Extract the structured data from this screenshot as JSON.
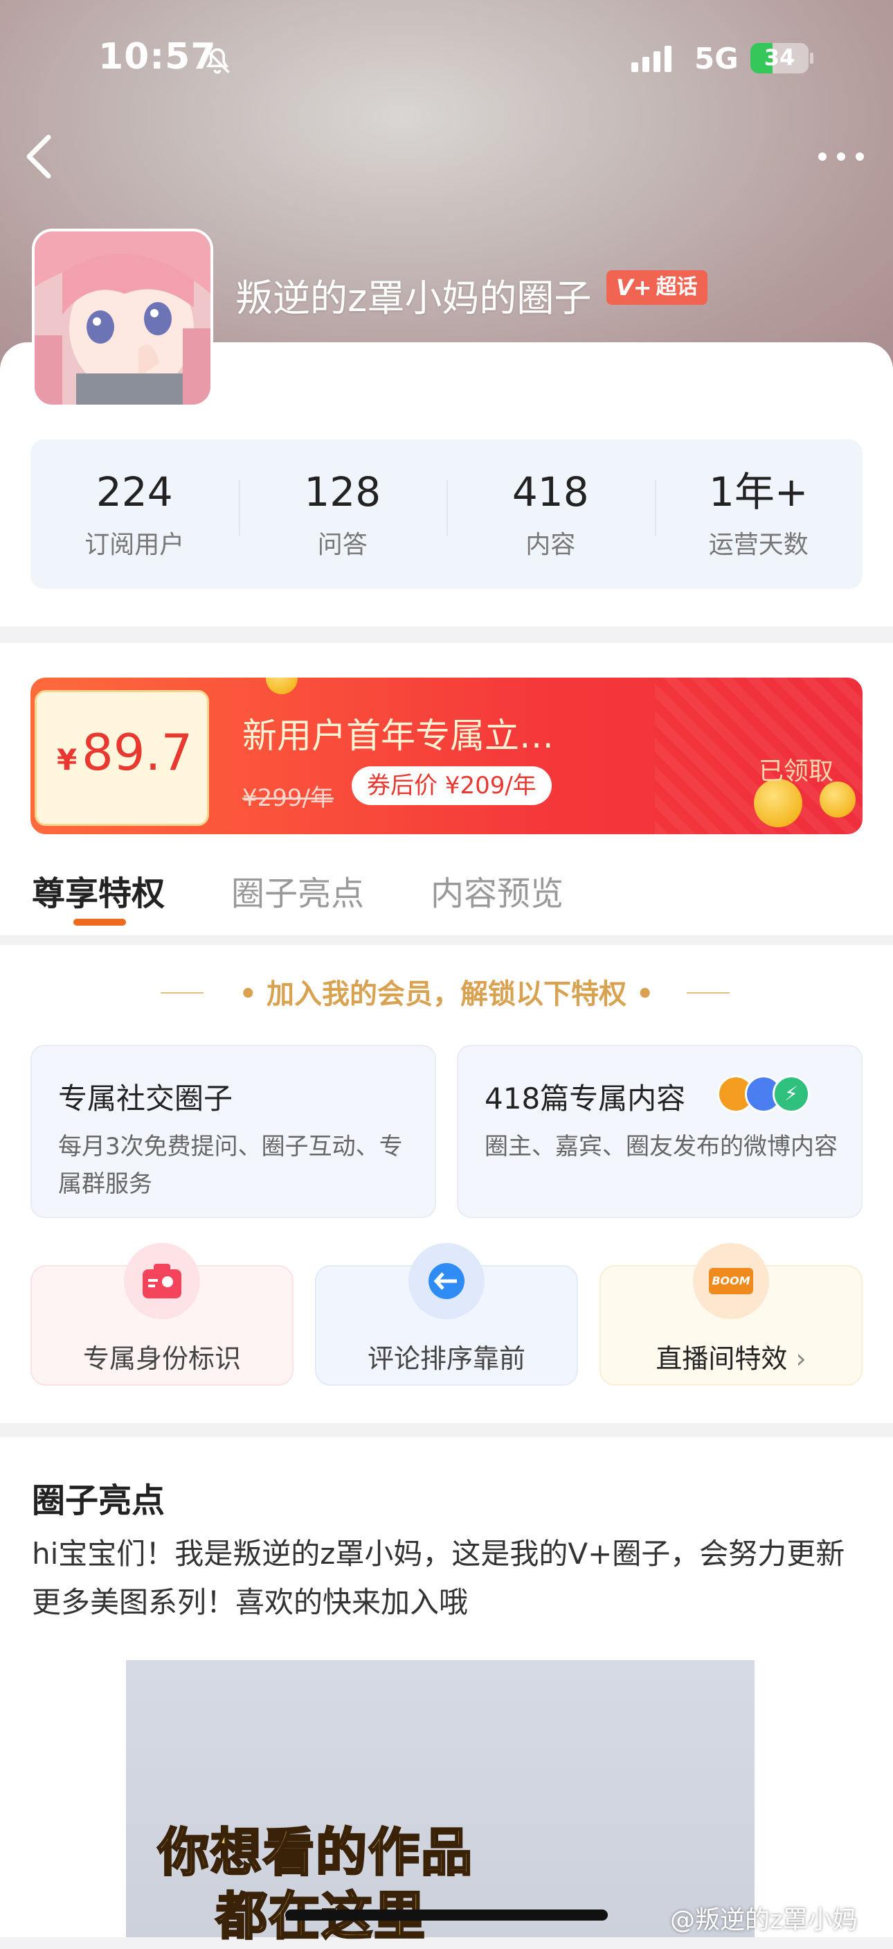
{
  "status_bar": {
    "time": "10:57",
    "network": "5G",
    "battery": "34"
  },
  "header": {
    "title": "叛逆的z罩小妈的圈子",
    "badge": "超话"
  },
  "stats": [
    {
      "value": "224",
      "label": "订阅用户"
    },
    {
      "value": "128",
      "label": "问答"
    },
    {
      "value": "418",
      "label": "内容"
    },
    {
      "value": "1年+",
      "label": "运营天数"
    }
  ],
  "coupon": {
    "currency": "¥",
    "price": "89.7",
    "title": "新用户首年专属立…",
    "old_price": "¥299/年",
    "after_price": "券后价 ¥209/年",
    "status": "已领取"
  },
  "tabs": [
    "尊享特权",
    "圈子亮点",
    "内容预览"
  ],
  "privileges": {
    "heading": "加入我的会员，解锁以下特权",
    "cards": [
      {
        "title": "专属社交圈子",
        "desc": "每月3次免费提问、圈子互动、专属群服务"
      },
      {
        "title": "418篇专属内容",
        "desc": "圈主、嘉宾、圈友发布的微博内容"
      }
    ],
    "items": [
      {
        "label": "专属身份标识"
      },
      {
        "label": "评论排序靠前"
      },
      {
        "label": "直播间特效"
      }
    ],
    "boom_text": "BOOM"
  },
  "highlights": {
    "title": "圈子亮点",
    "text": "hi宝宝们！我是叛逆的z罩小妈，这是我的V+圈子，会努力更新更多美图系列！喜欢的快来加入哦",
    "preview_line1": "你想看的作品",
    "preview_line2": "都在这里"
  },
  "watermark": "@叛逆的z罩小妈",
  "colors": {
    "accent": "#f06a1e",
    "coupon_red": "#ef2f3c",
    "gold": "#d9a251"
  }
}
